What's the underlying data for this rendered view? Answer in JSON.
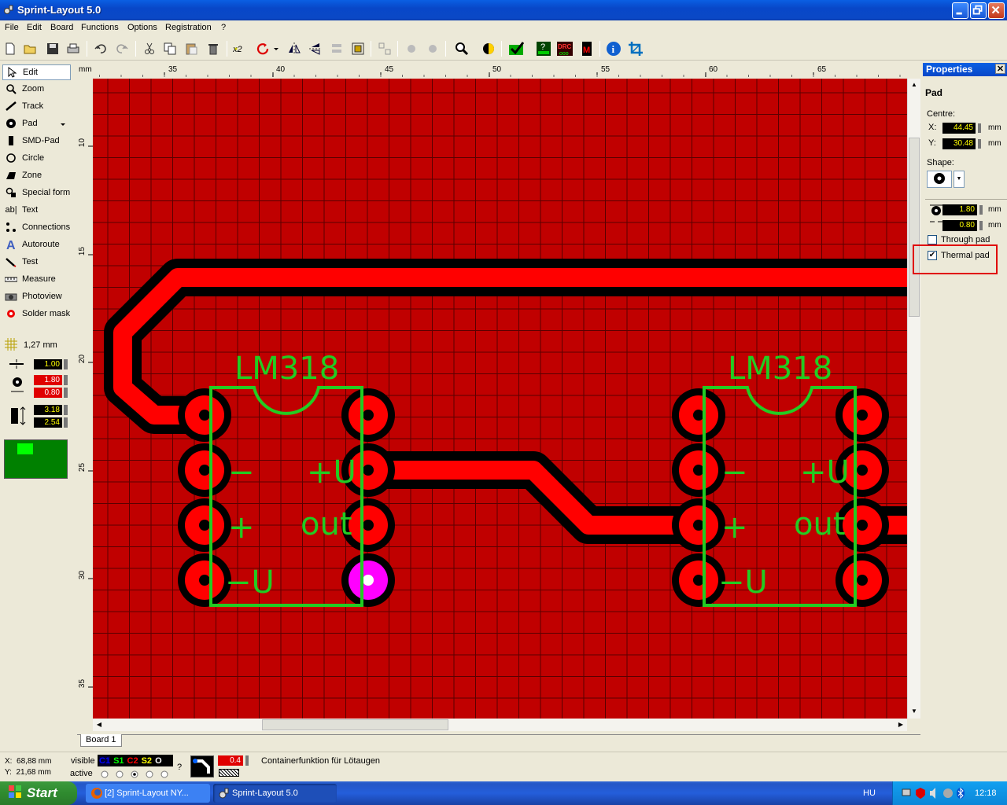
{
  "window": {
    "title": "Sprint-Layout 5.0"
  },
  "menu": [
    "File",
    "Edit",
    "Board",
    "Functions",
    "Options",
    "Registration",
    "?"
  ],
  "tools": [
    {
      "label": "Edit",
      "icon": "cursor-icon",
      "selected": true
    },
    {
      "label": "Zoom",
      "icon": "magnifier-icon"
    },
    {
      "label": "Track",
      "icon": "track-icon"
    },
    {
      "label": "Pad",
      "icon": "pad-icon"
    },
    {
      "label": "SMD-Pad",
      "icon": "smd-pad-icon"
    },
    {
      "label": "Circle",
      "icon": "circle-icon"
    },
    {
      "label": "Zone",
      "icon": "zone-icon"
    },
    {
      "label": "Special form",
      "icon": "special-form-icon"
    },
    {
      "label": "Text",
      "icon": "text-icon"
    },
    {
      "label": "Connections",
      "icon": "connections-icon"
    },
    {
      "label": "Autoroute",
      "icon": "autoroute-icon"
    },
    {
      "label": "Test",
      "icon": "test-icon"
    },
    {
      "label": "Measure",
      "icon": "measure-icon"
    },
    {
      "label": "Photoview",
      "icon": "camera-icon"
    },
    {
      "label": "Solder mask",
      "icon": "solder-mask-icon"
    }
  ],
  "grid": {
    "label": "1,27 mm"
  },
  "settings": {
    "track_width": "1.00",
    "pad_outer": "1.80",
    "pad_inner": "0.80",
    "smd_w": "3.18",
    "smd_h": "2.54"
  },
  "ruler": {
    "unit": "mm",
    "x_ticks": [
      "35",
      "40",
      "45",
      "50",
      "55",
      "60",
      "65"
    ],
    "y_ticks": [
      "10",
      "15",
      "20",
      "25",
      "30",
      "35"
    ]
  },
  "board": {
    "chips": [
      {
        "name": "LM318",
        "minus": "−",
        "plus": "+",
        "vplus": "+U",
        "out": "out",
        "vminus": "−U"
      },
      {
        "name": "LM318",
        "minus": "−",
        "plus": "+",
        "vplus": "+U",
        "out": "out",
        "vminus": "−U"
      }
    ],
    "tab": "Board 1"
  },
  "properties": {
    "title": "Properties",
    "type": "Pad",
    "centre_label": "Centre:",
    "x_label": "X:",
    "x_value": "44.45",
    "y_label": "Y:",
    "y_value": "30.48",
    "unit": "mm",
    "shape_label": "Shape:",
    "outer": "1.80",
    "inner": "0.80",
    "through_pad": "Through pad",
    "through_pad_checked": false,
    "thermal_pad": "Thermal pad",
    "thermal_pad_checked": true
  },
  "status": {
    "x": "X:  68,88 mm",
    "y": "Y:  21,68 mm",
    "visible_label": "visible",
    "active_label": "active",
    "layers": [
      "C1",
      "S1",
      "C2",
      "S2",
      "O"
    ],
    "question": "?",
    "value": "0.4",
    "message": "Containerfunktion für Lötaugen"
  },
  "taskbar": {
    "start": "Start",
    "tasks": [
      "[2] Sprint-Layout NY...",
      "Sprint-Layout 5.0"
    ],
    "lang": "HU",
    "clock": "12:18"
  },
  "colors": {
    "board": "#c00000",
    "copper": "#ff0000",
    "silkscreen": "#22cc22",
    "selected_pad": "#ff00ff",
    "xp_blue": "#0a5fe3"
  }
}
